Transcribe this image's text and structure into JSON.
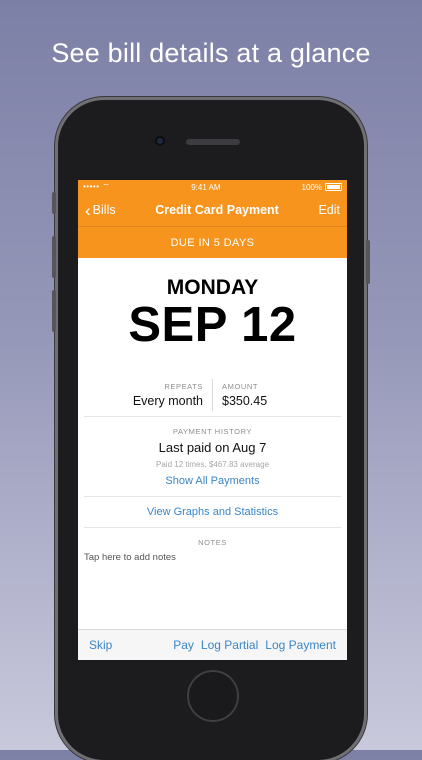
{
  "headline": "See bill details at a glance",
  "status_bar": {
    "signal": "•••••",
    "time": "9:41 AM",
    "battery": "100%"
  },
  "nav": {
    "back_label": "Bills",
    "title": "Credit Card Payment",
    "edit_label": "Edit"
  },
  "due_banner": "DUE IN 5 DAYS",
  "due_date": {
    "weekday": "MONDAY",
    "date": "SEP 12"
  },
  "details": {
    "repeats_label": "REPEATS",
    "repeats_value": "Every month",
    "amount_label": "AMOUNT",
    "amount_value": "$350.45"
  },
  "history": {
    "label": "PAYMENT HISTORY",
    "last_paid": "Last paid on Aug 7",
    "summary": "Paid 12 times, $467.83 average",
    "show_all": "Show All Payments"
  },
  "graphs_link": "View Graphs and Statistics",
  "notes": {
    "label": "NOTES",
    "placeholder": "Tap here to add notes"
  },
  "toolbar": {
    "skip": "Skip",
    "pay": "Pay",
    "log_partial": "Log Partial",
    "log_payment": "Log Payment"
  },
  "colors": {
    "accent": "#f7941e",
    "link": "#3a86c8"
  }
}
